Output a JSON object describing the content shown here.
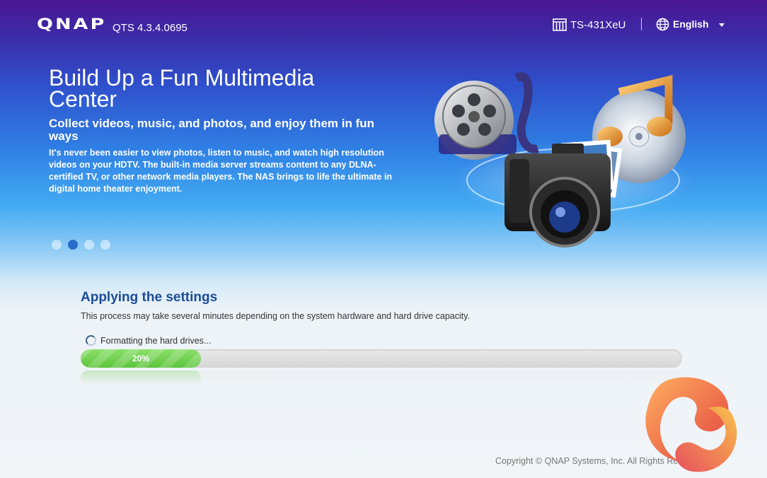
{
  "header": {
    "logo": "QNAP",
    "version": "QTS 4.3.4.0695",
    "model": "TS-431XeU",
    "language": "English",
    "icons": [
      "nas-icon",
      "globe-icon",
      "caret-down-icon"
    ]
  },
  "hero": {
    "title": "Build Up a Fun Multimedia Center",
    "subtitle": "Collect videos, music, and photos, and enjoy them in fun ways",
    "description": "It's never been easier to view photos, listen to music, and watch high resolution videos on your HDTV. The built-in media server streams content to any DLNA-certified TV, or other network media players. The NAS brings to life the ultimate in digital home theater enjoyment.",
    "carousel": {
      "count": 4,
      "active_index": 1
    }
  },
  "apply": {
    "title": "Applying the settings",
    "description": "This process may take several minutes depending on the system hardware and hard drive capacity.",
    "status": "Formatting the hard drives...",
    "progress_value": 20,
    "progress_label": "20%"
  },
  "footer": {
    "copyright": "Copyright © QNAP Systems, Inc. All Rights Reserved."
  },
  "colors": {
    "accent_title": "#1c4c96",
    "progress_green": "#5cc43b",
    "active_dot": "#2a6cc8"
  }
}
